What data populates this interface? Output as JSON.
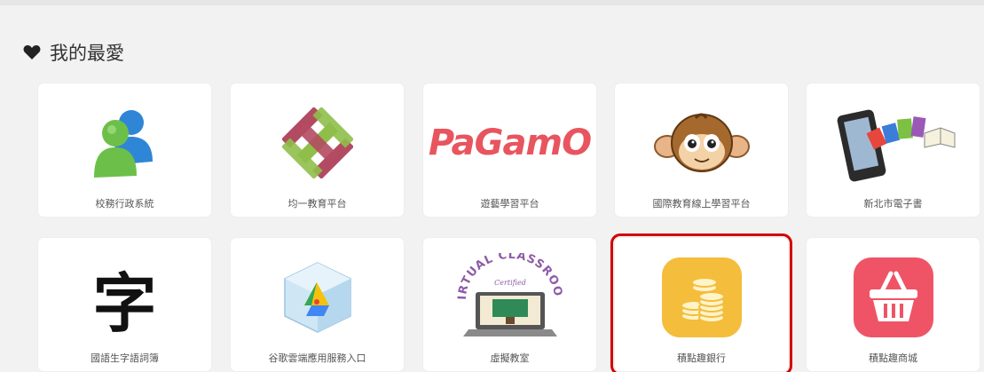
{
  "section": {
    "title": "我的最愛"
  },
  "tiles": [
    {
      "label": "校務行政系統",
      "icon": "messenger-people-icon"
    },
    {
      "label": "均一教育平台",
      "icon": "woven-pattern-icon"
    },
    {
      "label": "遊藝學習平台",
      "icon": "pagamo-logo",
      "logo_text": "PaGamO"
    },
    {
      "label": "國際教育線上學習平台",
      "icon": "monkey-face-icon"
    },
    {
      "label": "新北市電子書",
      "icon": "ebook-tablet-icon"
    },
    {
      "label": "國語生字語詞簿",
      "icon": "chinese-character-icon",
      "glyph": "字"
    },
    {
      "label": "谷歌雲端應用服務入口",
      "icon": "google-apps-cube-icon"
    },
    {
      "label": "虛擬教室",
      "icon": "virtual-classroom-icon",
      "badge_text": "VIRTUAL CLASSROOM",
      "badge_sub": "Certified"
    },
    {
      "label": "積點趣銀行",
      "icon": "coin-stack-icon",
      "selected": true
    },
    {
      "label": "積點趣商城",
      "icon": "shopping-basket-icon"
    }
  ],
  "colors": {
    "panel_bg": "#f2f2f2",
    "selection": "#d40000",
    "pagamo_red": "#e8555f",
    "bank_yellow": "#f4bd3c",
    "mall_red": "#ef5466"
  }
}
